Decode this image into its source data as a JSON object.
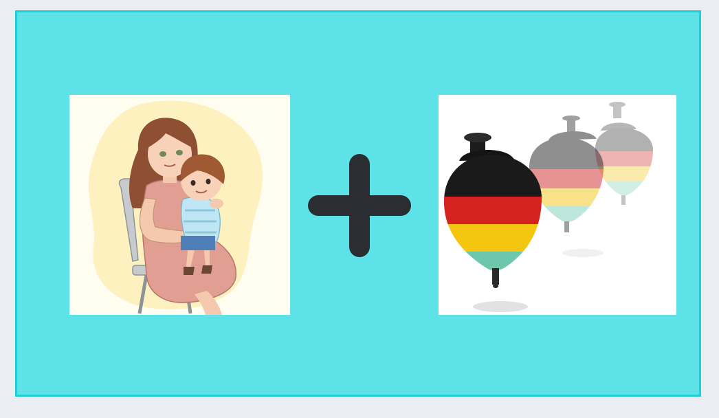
{
  "scene": {
    "left_image": {
      "icon": "mother-with-child-illustration-icon",
      "background_color": "#fffcf0",
      "blob_color": "#fdf1bf"
    },
    "operator": {
      "icon": "plus-icon",
      "color": "#2a2e33"
    },
    "right_image": {
      "icon": "spinning-tops-photo-icon",
      "background_color": "#ffffff"
    },
    "colors": {
      "page_background": "#eaedf1",
      "panel_fill": "#5de3e7",
      "panel_border": "#1fcfd6"
    }
  }
}
